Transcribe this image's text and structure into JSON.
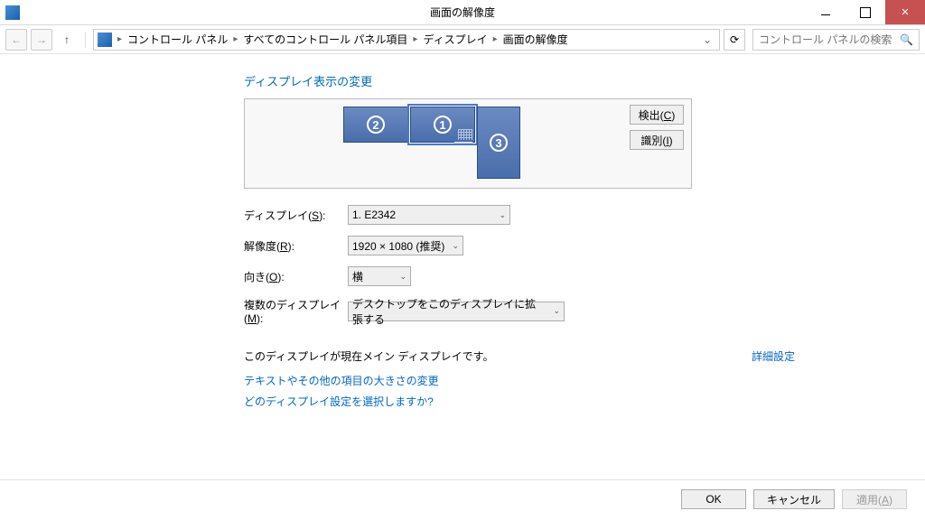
{
  "window": {
    "title": "画面の解像度"
  },
  "breadcrumb": {
    "items": [
      "コントロール パネル",
      "すべてのコントロール パネル項目",
      "ディスプレイ",
      "画面の解像度"
    ]
  },
  "search": {
    "placeholder": "コントロール パネルの検索"
  },
  "heading": "ディスプレイ表示の変更",
  "detect_btn": "検出(C)",
  "identify_btn": "識別(I)",
  "monitors": {
    "m1": "1",
    "m2": "2",
    "m3": "3"
  },
  "labels": {
    "display": "ディスプレイ(S):",
    "resolution": "解像度(R):",
    "orientation": "向き(O):",
    "multi": "複数のディスプレイ(M):"
  },
  "values": {
    "display": "1. E2342",
    "resolution": "1920 × 1080 (推奨)",
    "orientation": "横",
    "multi": "デスクトップをこのディスプレイに拡張する"
  },
  "main_msg": "このディスプレイが現在メイン ディスプレイです。",
  "adv_settings": "詳細設定",
  "link1": "テキストやその他の項目の大きさの変更",
  "link2": "どのディスプレイ設定を選択しますか?",
  "buttons": {
    "ok": "OK",
    "cancel": "キャンセル",
    "apply": "適用(A)"
  }
}
